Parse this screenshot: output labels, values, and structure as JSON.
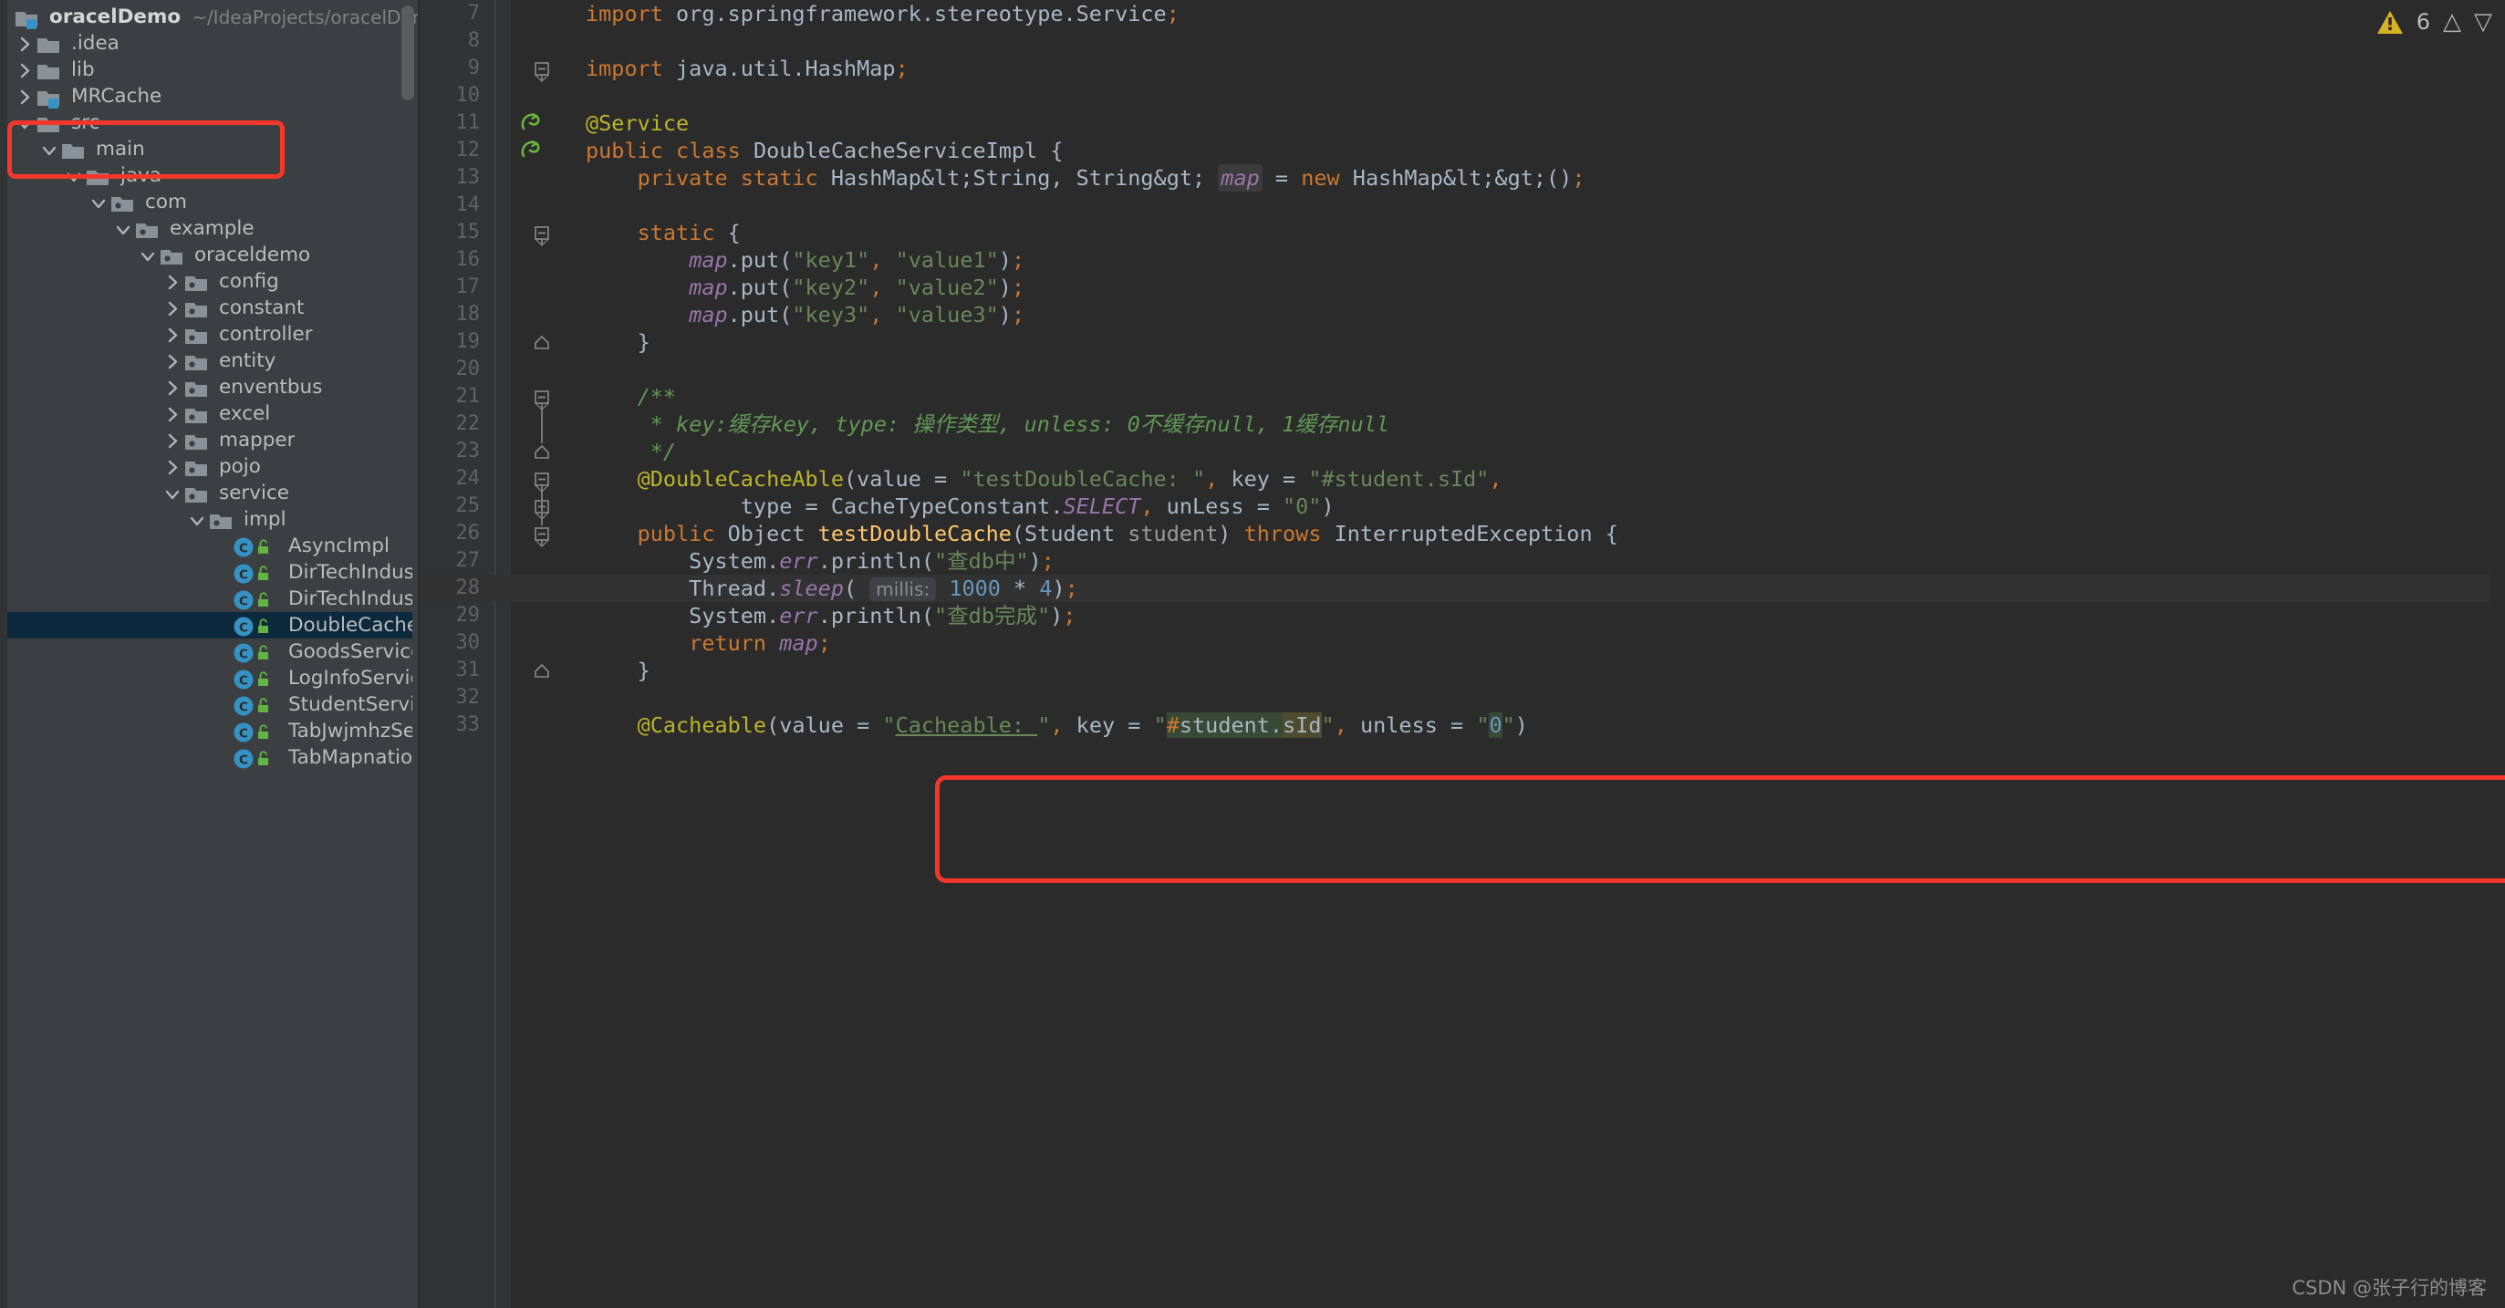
{
  "project": {
    "name": "oracelDemo",
    "path": "~/IdeaProjects/oracelDemo",
    "tree": [
      {
        "label": ".idea",
        "icon": "folder",
        "arrow": "right",
        "depth": 1
      },
      {
        "label": "lib",
        "icon": "folder",
        "arrow": "right",
        "depth": 1
      },
      {
        "label": "MRCache",
        "icon": "module",
        "arrow": "right",
        "depth": 1,
        "highlighted": true
      },
      {
        "label": "src",
        "icon": "folder",
        "arrow": "down",
        "depth": 1
      },
      {
        "label": "main",
        "icon": "folder",
        "arrow": "down",
        "depth": 2
      },
      {
        "label": "java",
        "icon": "folder",
        "arrow": "down",
        "depth": 3
      },
      {
        "label": "com",
        "icon": "package",
        "arrow": "down",
        "depth": 4
      },
      {
        "label": "example",
        "icon": "package",
        "arrow": "down",
        "depth": 5
      },
      {
        "label": "oraceldemo",
        "icon": "package",
        "arrow": "down",
        "depth": 6
      },
      {
        "label": "config",
        "icon": "package",
        "arrow": "right",
        "depth": 7
      },
      {
        "label": "constant",
        "icon": "package",
        "arrow": "right",
        "depth": 7
      },
      {
        "label": "controller",
        "icon": "package",
        "arrow": "right",
        "depth": 7
      },
      {
        "label": "entity",
        "icon": "package",
        "arrow": "right",
        "depth": 7
      },
      {
        "label": "enventbus",
        "icon": "package",
        "arrow": "right",
        "depth": 7
      },
      {
        "label": "excel",
        "icon": "package",
        "arrow": "right",
        "depth": 7
      },
      {
        "label": "mapper",
        "icon": "package",
        "arrow": "right",
        "depth": 7
      },
      {
        "label": "pojo",
        "icon": "package",
        "arrow": "right",
        "depth": 7
      },
      {
        "label": "service",
        "icon": "package",
        "arrow": "down",
        "depth": 7
      },
      {
        "label": "impl",
        "icon": "package",
        "arrow": "down",
        "depth": 8
      },
      {
        "label": "AsyncImpl",
        "icon": "class",
        "arrow": "none",
        "depth": 9
      },
      {
        "label": "DirTechIndustryO",
        "icon": "class",
        "arrow": "none",
        "depth": 9
      },
      {
        "label": "DirTechIndustryS",
        "icon": "class",
        "arrow": "none",
        "depth": 9
      },
      {
        "label": "DoubleCacheServi",
        "icon": "class",
        "arrow": "none",
        "depth": 9,
        "selected": true
      },
      {
        "label": "GoodsServiceImpl",
        "icon": "class",
        "arrow": "none",
        "depth": 9
      },
      {
        "label": "LogInfoServiceImp",
        "icon": "class",
        "arrow": "none",
        "depth": 9
      },
      {
        "label": "StudentServiceImp",
        "icon": "class",
        "arrow": "none",
        "depth": 9
      },
      {
        "label": "TabJwjmhzService",
        "icon": "class",
        "arrow": "none",
        "depth": 9
      },
      {
        "label": "TabMapnationSer",
        "icon": "class",
        "arrow": "none",
        "depth": 9
      }
    ]
  },
  "inspection": {
    "warning_icon": "warning-triangle-icon",
    "warning_count": "6",
    "prev_icon": "chevron-up-icon",
    "next_icon": "chevron-down-icon"
  },
  "watermark": "CSDN @张子行的博客",
  "editor": {
    "file": "DoubleCacheServiceImpl.java",
    "first_visible_line": 7,
    "caret_line": 28,
    "lines": [
      {
        "n": "7",
        "text": "import org.springframework.stereotype.Service;"
      },
      {
        "n": "8",
        "text": ""
      },
      {
        "n": "9",
        "text": "import java.util.HashMap;"
      },
      {
        "n": "10",
        "text": ""
      },
      {
        "n": "11",
        "text": "@Service"
      },
      {
        "n": "12",
        "text": "public class DoubleCacheServiceImpl {"
      },
      {
        "n": "13",
        "text": "    private static HashMap<String, String> map = new HashMap<>();"
      },
      {
        "n": "14",
        "text": ""
      },
      {
        "n": "15",
        "text": "    static {"
      },
      {
        "n": "16",
        "text": "        map.put(\"key1\", \"value1\");"
      },
      {
        "n": "17",
        "text": "        map.put(\"key2\", \"value2\");"
      },
      {
        "n": "18",
        "text": "        map.put(\"key3\", \"value3\");"
      },
      {
        "n": "19",
        "text": "    }"
      },
      {
        "n": "20",
        "text": ""
      },
      {
        "n": "21",
        "text": "    /**"
      },
      {
        "n": "22",
        "text": "     * key:缓存key, type: 操作类型, unless: 0不缓存null, 1缓存null"
      },
      {
        "n": "23",
        "text": "     */"
      },
      {
        "n": "24",
        "text": "    @DoubleCacheAble(value = \"testDoubleCache: \", key = \"#student.sId\","
      },
      {
        "n": "25",
        "text": "            type = CacheTypeConstant.SELECT, unLess = \"0\")"
      },
      {
        "n": "26",
        "text": "    public Object testDoubleCache(Student student) throws InterruptedException {"
      },
      {
        "n": "27",
        "text": "        System.err.println(\"查db中\");"
      },
      {
        "n": "28",
        "text": "        Thread.sleep( millis: 1000 * 4);"
      },
      {
        "n": "29",
        "text": "        System.err.println(\"查db完成\");"
      },
      {
        "n": "30",
        "text": "        return map;"
      },
      {
        "n": "31",
        "text": "    }"
      },
      {
        "n": "32",
        "text": ""
      },
      {
        "n": "33",
        "text": "    @Cacheable(value = \"Cacheable: \", key = \"#student.sId\", unless = \"0\")"
      }
    ],
    "inlay_hints": [
      {
        "line": "28",
        "text": "millis:"
      }
    ],
    "gutter_icons": [
      {
        "line": "11",
        "name": "spring-bean-gutter-icon"
      },
      {
        "line": "12",
        "name": "spring-bean-gutter-icon"
      }
    ]
  },
  "colors": {
    "editor_bg": "#2b2b2b",
    "gutter_bg": "#313335",
    "sidebar_bg": "#3c3f41",
    "selection_bg": "#0d293e",
    "caret_line_bg": "#323232",
    "keyword": "#cc7832",
    "string": "#6a8759",
    "number": "#6897bb",
    "annotation": "#bbb529",
    "field": "#9876aa",
    "method": "#ffc66d",
    "comment": "#629755",
    "plain": "#a9b7c6",
    "annotation_box": "#f5362a",
    "warning": "#d9b125"
  },
  "annotations": [
    {
      "name": "mrcache-highlight-box",
      "target": "MRCache"
    },
    {
      "name": "code-highlight-box",
      "target": "@DoubleCacheAble lines 24-25"
    }
  ]
}
